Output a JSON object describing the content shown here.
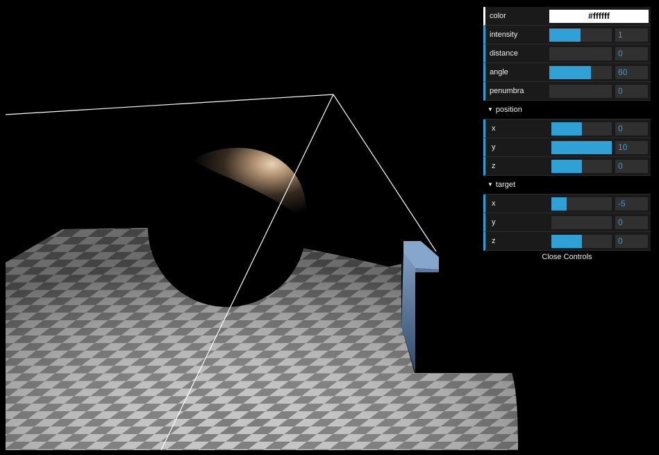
{
  "gui": {
    "color": {
      "label": "color",
      "value": "#ffffff"
    },
    "intensity": {
      "label": "intensity",
      "value": "1",
      "fill": 0.5
    },
    "distance": {
      "label": "distance",
      "value": "0",
      "fill": 0
    },
    "angle": {
      "label": "angle",
      "value": "60",
      "fill": 0.67
    },
    "penumbra": {
      "label": "penumbra",
      "value": "0",
      "fill": 0
    },
    "position": {
      "title": "position",
      "x": {
        "label": "x",
        "value": "0",
        "fill": 0.5
      },
      "y": {
        "label": "y",
        "value": "10",
        "fill": 1
      },
      "z": {
        "label": "z",
        "value": "0",
        "fill": 0.5
      }
    },
    "target": {
      "title": "target",
      "x": {
        "label": "x",
        "value": "-5",
        "fill": 0.25
      },
      "y": {
        "label": "y",
        "value": "0",
        "fill": 0
      },
      "z": {
        "label": "z",
        "value": "0",
        "fill": 0.5
      }
    },
    "close_label": "Close Controls"
  },
  "colors": {
    "accent": "#2fa1d6",
    "checker_light": "#c0c0c0",
    "checker_dark": "#777777",
    "box": "#8aa3c2",
    "background": "#000000"
  }
}
